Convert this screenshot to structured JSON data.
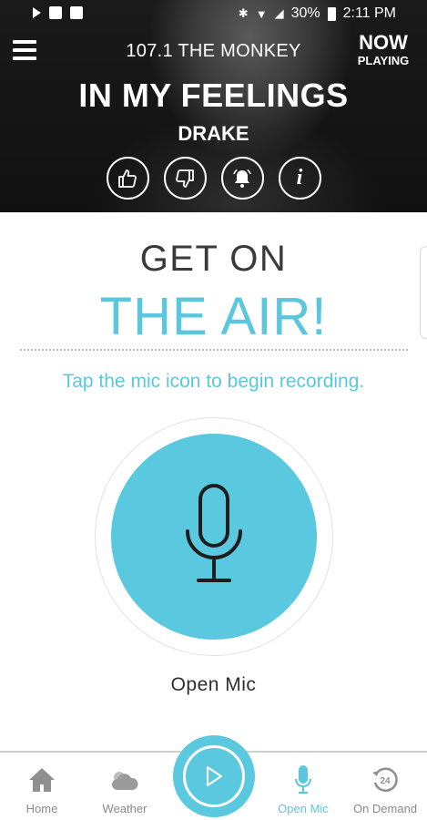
{
  "status_bar": {
    "battery": "30%",
    "time": "2:11 PM"
  },
  "header": {
    "station": "107.1 THE MONKEY",
    "now_playing_top": "NOW",
    "now_playing_bottom": "PLAYING",
    "song_title": "IN MY FEELINGS",
    "artist": "DRAKE",
    "info_glyph": "i"
  },
  "main": {
    "headline_1": "GET ON",
    "headline_2": "THE AIR!",
    "instruction": "Tap the mic icon to begin recording.",
    "mic_label": "Open Mic"
  },
  "nav": {
    "items": [
      {
        "label": "Home",
        "icon": "home-icon"
      },
      {
        "label": "Weather",
        "icon": "weather-icon"
      },
      {
        "label": "Open Mic",
        "icon": "mic-icon"
      },
      {
        "label": "On Demand",
        "icon": "on-demand-icon"
      }
    ],
    "on_demand_badge": "24",
    "active": "Open Mic"
  },
  "colors": {
    "accent": "#5bc6dd",
    "header_bg": "#151515",
    "text_dark": "#3a3a3a",
    "nav_gray": "#8a8a8a"
  }
}
